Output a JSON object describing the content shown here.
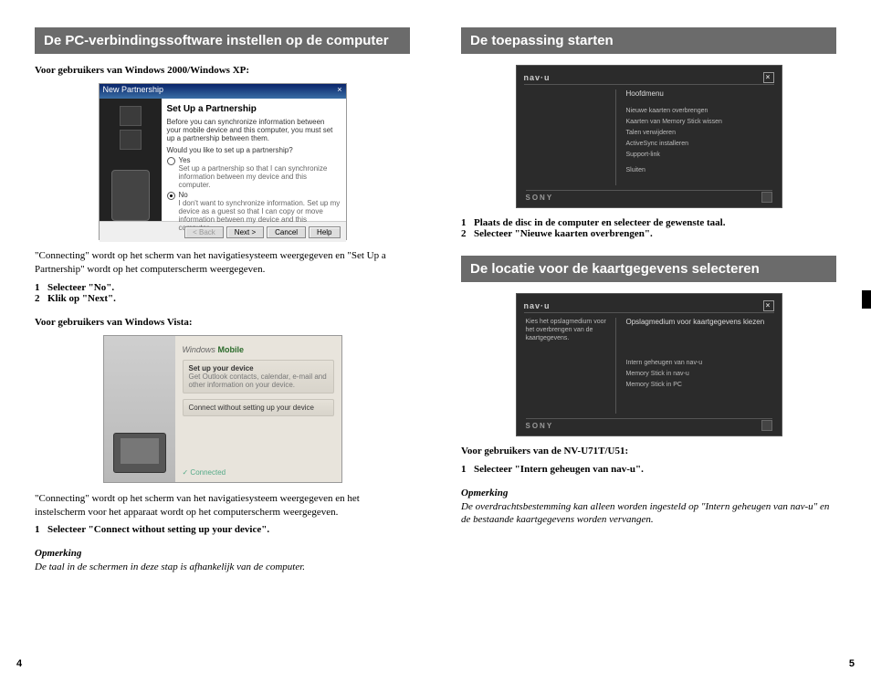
{
  "left": {
    "heading": "De PC-verbindingssoftware instellen op de computer",
    "sub_xp": "Voor gebruikers van Windows 2000/Windows XP:",
    "xp_dialog": {
      "title": "New Partnership",
      "close": "×",
      "heading": "Set Up a Partnership",
      "intro": "Before you can synchronize information between your mobile device and this computer, you must set up a partnership between them.",
      "question": "Would you like to set up a partnership?",
      "opt_yes": "Yes",
      "opt_yes_desc": "Set up a partnership so that I can synchronize information between my device and this computer.",
      "opt_no": "No",
      "opt_no_desc": "I don't want to synchronize information. Set up my device as a guest so that I can copy or move information between my device and this computer.",
      "btn_back": "< Back",
      "btn_next": "Next >",
      "btn_cancel": "Cancel",
      "btn_help": "Help"
    },
    "xp_body": "\"Connecting\" wordt op het scherm van het navigatiesysteem weergegeven en \"Set Up a Partnership\" wordt op het computerscherm weergegeven.",
    "xp_step1_n": "1",
    "xp_step1": "Selecteer \"No\".",
    "xp_step2_n": "2",
    "xp_step2": "Klik op \"Next\".",
    "sub_vista": "Voor gebruikers van Windows Vista:",
    "vista": {
      "brand1": "Windows",
      "brand2": "Mobile",
      "row1_h": "Set up your device",
      "row1_b": "Get Outlook contacts, calendar, e-mail and other information on your device.",
      "row2": "Connect without setting up your device",
      "status": "✓  Connected"
    },
    "vista_body": "\"Connecting\" wordt op het scherm van het navigatiesysteem weergegeven en het instelscherm voor het apparaat wordt op het computerscherm weergegeven.",
    "vista_step1_n": "1",
    "vista_step1": "Selecteer \"Connect without setting up your device\".",
    "note_h": "Opmerking",
    "note": "De taal in de schermen in deze stap is afhankelijk van de computer.",
    "page": "4"
  },
  "right": {
    "heading1": "De toepassing starten",
    "navu1": {
      "brand": "nav·u",
      "close": "×",
      "main_h": "Hoofdmenu",
      "items": [
        "Nieuwe kaarten overbrengen",
        "Kaarten van Memory Stick wissen",
        "Talen verwijderen",
        "ActiveSync installeren",
        "Support-link",
        "",
        "Sluiten"
      ],
      "footer": "SONY"
    },
    "s1_step1_n": "1",
    "s1_step1": "Plaats de disc in de computer en selecteer de gewenste taal.",
    "s1_step2_n": "2",
    "s1_step2": "Selecteer \"Nieuwe kaarten overbrengen\".",
    "heading2": "De locatie voor de kaartgegevens selecteren",
    "navu2": {
      "brand": "nav·u",
      "close": "×",
      "side": "Kies het opslagmedium voor het overbrengen van de kaartgegevens.",
      "main_h": "Opslagmedium voor kaartgegevens kiezen",
      "items": [
        "Intern geheugen van nav-u",
        "Memory Stick in nav-u",
        "Memory Stick in PC"
      ],
      "footer": "SONY"
    },
    "sub2": "Voor gebruikers van de NV-U71T/U51:",
    "s2_step1_n": "1",
    "s2_step1": "Selecteer \"Intern geheugen van nav-u\".",
    "note_h": "Opmerking",
    "note": "De overdrachtsbestemming kan alleen worden ingesteld op \"Intern geheugen van nav-u\" en de bestaande kaartgegevens worden vervangen.",
    "page": "5"
  }
}
